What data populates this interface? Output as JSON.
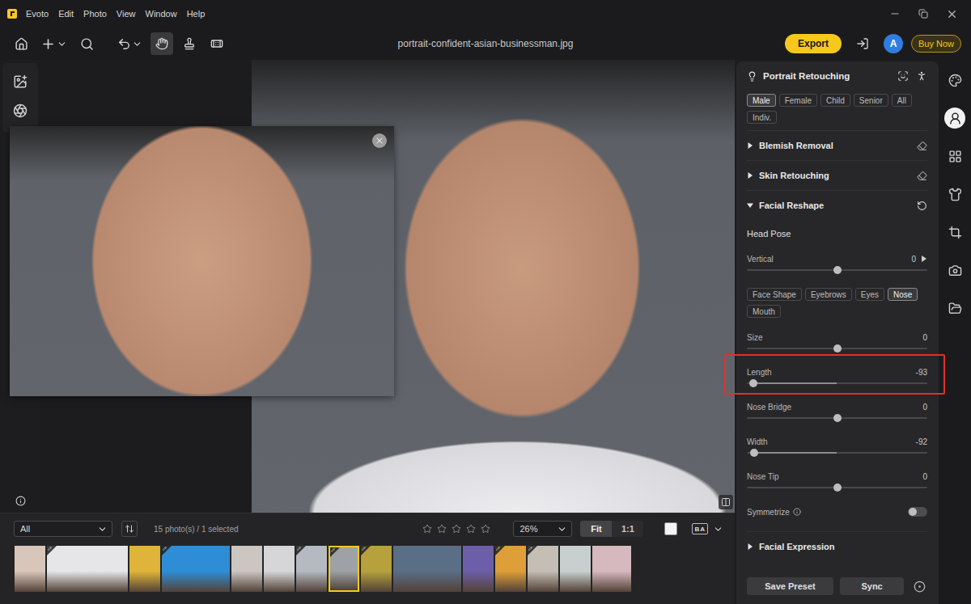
{
  "window": {
    "title": "Evoto",
    "menu": [
      "Edit",
      "Photo",
      "View",
      "Window",
      "Help"
    ]
  },
  "toolbar": {
    "filename": "portrait-confident-asian-businessman.jpg",
    "tools": [
      {
        "kind": "hand",
        "selected": true
      },
      {
        "kind": "stamp",
        "selected": false
      },
      {
        "kind": "heal",
        "selected": false
      }
    ],
    "export": "Export",
    "avatar": "A",
    "buy": "Buy Now"
  },
  "panel": {
    "title": "Portrait Retouching",
    "presets": [
      {
        "label": "Male",
        "selected": true
      },
      {
        "label": "Female",
        "selected": false
      },
      {
        "label": "Child",
        "selected": false
      },
      {
        "label": "Senior",
        "selected": false
      },
      {
        "label": "All",
        "selected": false
      },
      {
        "label": "Indiv.",
        "selected": false
      }
    ],
    "sections": [
      {
        "label": "Blemish Removal",
        "kind": "tool",
        "expanded": false
      },
      {
        "label": "Skin Retouching",
        "kind": "tool",
        "expanded": false
      },
      {
        "label": "Facial Reshape",
        "kind": "reshape",
        "expanded": true
      },
      {
        "label": "Facial Expression",
        "kind": "plain",
        "expanded": false
      }
    ],
    "reshape": {
      "head_pose": {
        "label": "Head Pose",
        "slider": {
          "label": "Vertical",
          "reading": "0",
          "level": 0.5
        }
      },
      "features": [
        {
          "label": "Face Shape",
          "selected": false
        },
        {
          "label": "Eyebrows",
          "selected": false
        },
        {
          "label": "Eyes",
          "selected": false
        },
        {
          "label": "Nose",
          "selected": true
        },
        {
          "label": "Mouth",
          "selected": false
        }
      ],
      "sliders": [
        {
          "label": "Size",
          "reading": "0",
          "level": 0.5,
          "highlighted": false
        },
        {
          "label": "Length",
          "reading": "-93",
          "level": 0.035,
          "highlighted": true
        },
        {
          "label": "Nose Bridge",
          "reading": "0",
          "level": 0.5,
          "highlighted": false
        },
        {
          "label": "Width",
          "reading": "-92",
          "level": 0.04,
          "highlighted": false
        },
        {
          "label": "Nose Tip",
          "reading": "0",
          "level": 0.5,
          "highlighted": false
        }
      ],
      "symmetrize": {
        "label": "Symmetrize",
        "on": false
      }
    },
    "buttons": [
      "Save Preset",
      "Sync"
    ]
  },
  "rail": [
    {
      "kind": "palette",
      "selected": false
    },
    {
      "kind": "face",
      "selected": true
    },
    {
      "kind": "grid",
      "selected": false
    },
    {
      "kind": "shirt",
      "selected": false
    },
    {
      "kind": "crop",
      "selected": false
    },
    {
      "kind": "camera",
      "selected": false
    },
    {
      "kind": "folder",
      "selected": false
    }
  ],
  "filmstrip": {
    "filter": "All",
    "count": "15 photo(s) / 1 selected",
    "stars": 0,
    "zoom": "26%",
    "fit_modes": [
      {
        "label": "Fit",
        "selected": true
      },
      {
        "label": "1:1",
        "selected": false
      }
    ],
    "compare": "BA",
    "thumbnails": [
      {
        "kind": "narrow",
        "color": "#d8c6ba",
        "edited": false,
        "selected": false
      },
      {
        "kind": "xwide",
        "color": "#e6e6e8",
        "edited": true,
        "selected": false
      },
      {
        "kind": "narrow",
        "color": "#e0b33a",
        "edited": false,
        "selected": false
      },
      {
        "kind": "wide",
        "color": "#2f8dd6",
        "edited": true,
        "selected": false
      },
      {
        "kind": "narrow",
        "color": "#cbc6c2",
        "edited": false,
        "selected": false
      },
      {
        "kind": "narrow",
        "color": "#d6d6d8",
        "edited": false,
        "selected": false
      },
      {
        "kind": "narrow",
        "color": "#b4b9c2",
        "edited": true,
        "selected": false
      },
      {
        "kind": "narrow",
        "color": "#9ea2a6",
        "edited": true,
        "selected": true
      },
      {
        "kind": "narrow",
        "color": "#b6a13c",
        "edited": true,
        "selected": false
      },
      {
        "kind": "wide",
        "color": "#5a6e86",
        "edited": false,
        "selected": false
      },
      {
        "kind": "narrow",
        "color": "#6c5ea8",
        "edited": false,
        "selected": false
      },
      {
        "kind": "narrow",
        "color": "#de9f38",
        "edited": true,
        "selected": false
      },
      {
        "kind": "narrow",
        "color": "#c4beb4",
        "edited": true,
        "selected": false
      },
      {
        "kind": "narrow",
        "color": "#c8d0cf",
        "edited": false,
        "selected": false
      },
      {
        "kind": "medium",
        "color": "#d6b8bf",
        "edited": false,
        "selected": false
      }
    ]
  }
}
